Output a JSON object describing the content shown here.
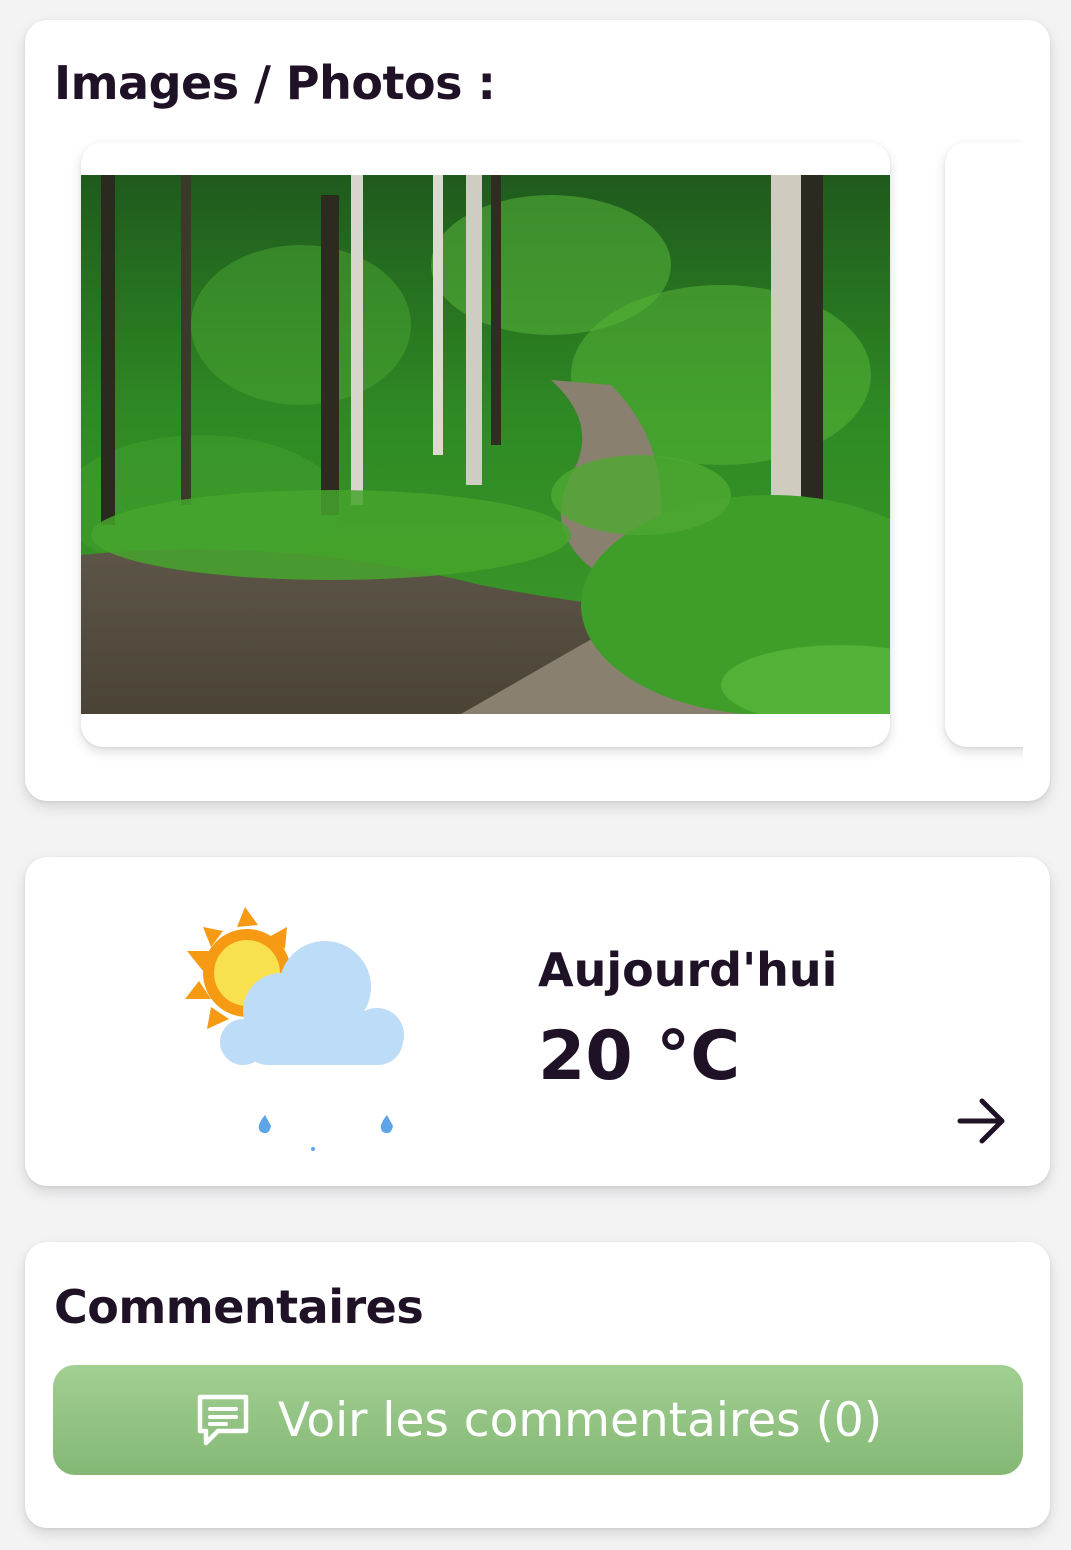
{
  "photos": {
    "title": "Images / Photos :",
    "items": [
      {
        "subject": "forest-path-photo"
      },
      {
        "subject": "next-photo-partial"
      }
    ]
  },
  "weather": {
    "label": "Aujourd'hui",
    "temperature": "20 °C",
    "icon": "sun-behind-rain-cloud-icon"
  },
  "comments": {
    "title": "Commentaires",
    "button_label": "Voir les commentaires (0)",
    "button_icon": "comment-icon"
  },
  "colors": {
    "text": "#1f1226",
    "button_green_top": "#a2cf93",
    "button_green_bottom": "#84b874",
    "card_background": "#ffffff"
  }
}
